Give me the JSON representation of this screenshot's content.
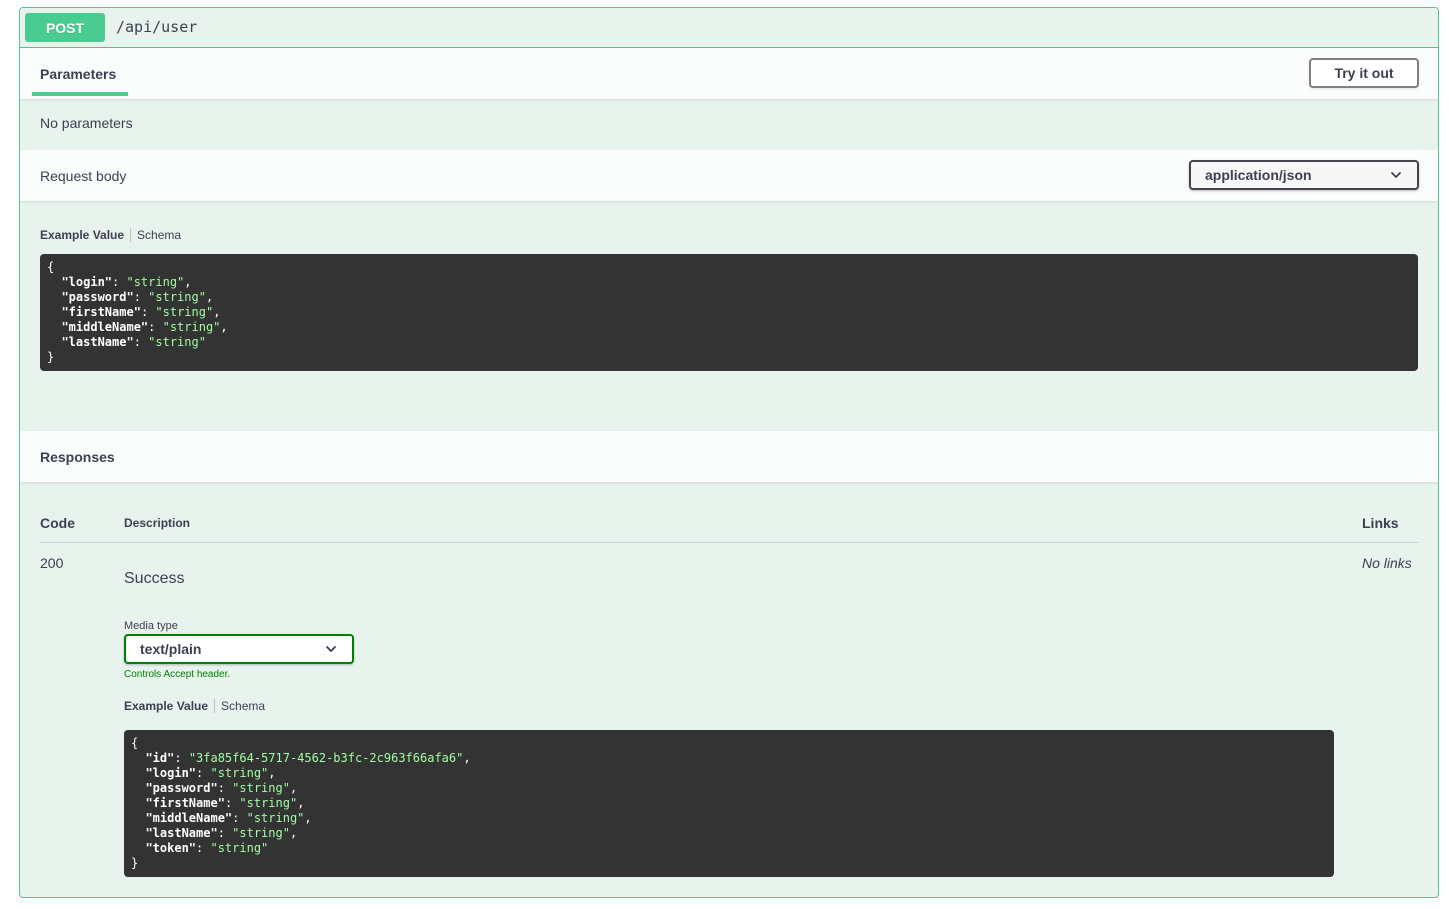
{
  "operation": {
    "method": "POST",
    "path": "/api/user"
  },
  "parameters": {
    "tab_label": "Parameters",
    "try_button": "Try it out",
    "no_params_text": "No parameters"
  },
  "request_body": {
    "label": "Request body",
    "content_type": "application/json",
    "tab_example": "Example Value",
    "tab_schema": "Schema",
    "example": [
      {
        "key": "login",
        "value": "string"
      },
      {
        "key": "password",
        "value": "string"
      },
      {
        "key": "firstName",
        "value": "string"
      },
      {
        "key": "middleName",
        "value": "string"
      },
      {
        "key": "lastName",
        "value": "string"
      }
    ]
  },
  "responses": {
    "title": "Responses",
    "columns": {
      "code": "Code",
      "description": "Description",
      "links": "Links"
    },
    "items": [
      {
        "code": "200",
        "description": "Success",
        "links": "No links",
        "media_type_label": "Media type",
        "media_type": "text/plain",
        "controls_note": "Controls Accept header.",
        "tab_example": "Example Value",
        "tab_schema": "Schema",
        "example": [
          {
            "key": "id",
            "value": "3fa85f64-5717-4562-b3fc-2c963f66afa6"
          },
          {
            "key": "login",
            "value": "string"
          },
          {
            "key": "password",
            "value": "string"
          },
          {
            "key": "firstName",
            "value": "string"
          },
          {
            "key": "middleName",
            "value": "string"
          },
          {
            "key": "lastName",
            "value": "string"
          },
          {
            "key": "token",
            "value": "string"
          }
        ]
      }
    ]
  },
  "colors": {
    "post_accent": "#49cc90",
    "block_background": "#e8f3ee",
    "code_background": "#333333",
    "code_string": "#a2fca2",
    "media_select_border": "#008000"
  }
}
